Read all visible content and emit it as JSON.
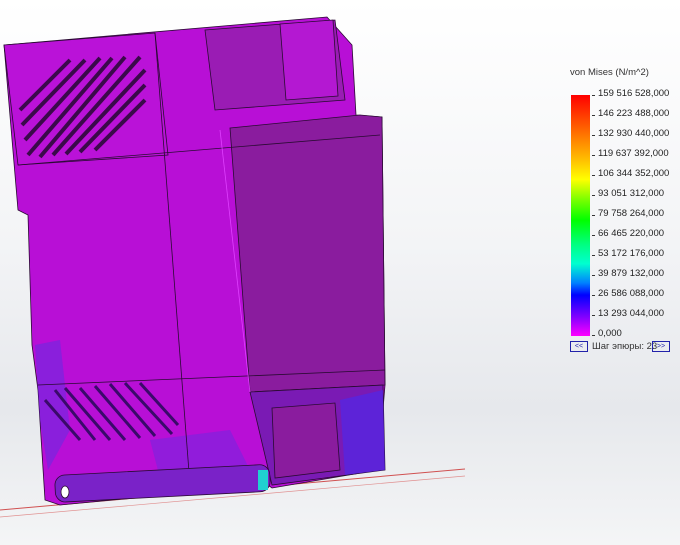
{
  "legend": {
    "title": "von Mises (N/m^2)",
    "labels": [
      "159 516 528,000",
      "146 223 488,000",
      "132 930 440,000",
      "119 637 392,000",
      "106 344 352,000",
      "93 051 312,000",
      "79 758 264,000",
      "66 465 220,000",
      "53 172 176,000",
      "39 879 132,000",
      "26 586 088,000",
      "13 293 044,000",
      "0,000"
    ],
    "step_label": "Шаг эпюры: 23",
    "prev_label": "<<",
    "next_label": ">>"
  },
  "colors": {
    "model_main": "#b80fd6",
    "model_dark": "#8a1c9e",
    "model_light": "#c81ee6",
    "stress_blue": "#5a1ee0",
    "background": "#eef0f2"
  }
}
